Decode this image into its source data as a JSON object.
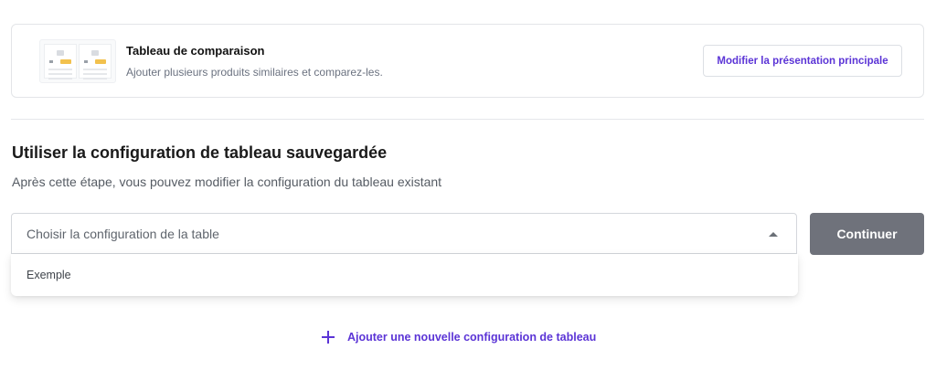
{
  "layout_card": {
    "title": "Tableau de comparaison",
    "subtitle": "Ajouter plusieurs produits similaires et comparez-les.",
    "modify_label": "Modifier la présentation principale",
    "thumbnail_icon": "comparison-table-thumbnail"
  },
  "saved_config": {
    "title": "Utiliser la configuration de tableau sauvegardée",
    "subtitle": "Après cette étape, vous pouvez modifier la configuration du tableau existant",
    "select_placeholder": "Choisir la configuration de la table",
    "options": [
      "Exemple"
    ],
    "continue_label": "Continuer"
  },
  "add_link": {
    "label": "Ajouter une nouvelle configuration de tableau",
    "icon": "plus-icon"
  },
  "colors": {
    "accent": "#5b34d6",
    "continue_button": "#6f727b",
    "thumbnail_highlight": "#f2c14e"
  }
}
